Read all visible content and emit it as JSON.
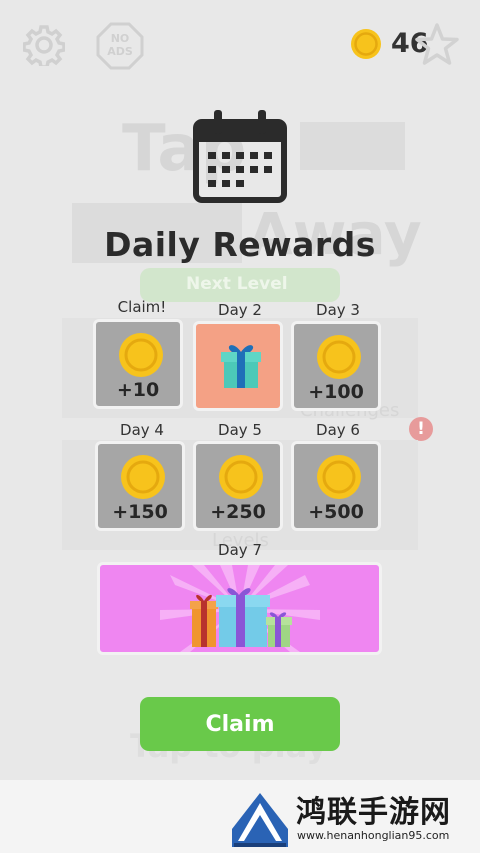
{
  "top_bar": {
    "settings_icon": "gear-icon",
    "no_ads_label": "NO\nADS",
    "no_ads_line1": "NO",
    "no_ads_line2": "ADS",
    "coin_icon": "coin-icon",
    "coin_count": "46",
    "star_icon": "star-icon"
  },
  "background": {
    "title_ghost": "Tap",
    "away_ghost": "Away",
    "next_level": "Next Level",
    "challenges": "Challenges",
    "alert": "!",
    "levels": "Levels",
    "tap_to_play": "Tap to play"
  },
  "modal": {
    "title": "Daily Rewards",
    "calendar_icon": "calendar-icon",
    "rewards": [
      {
        "label": "Claim!",
        "amount": "+10",
        "type": "coin",
        "state": "claimable"
      },
      {
        "label": "Day 2",
        "amount": "",
        "type": "gift",
        "state": "highlight"
      },
      {
        "label": "Day 3",
        "amount": "+100",
        "type": "coin",
        "state": "locked"
      },
      {
        "label": "Day 4",
        "amount": "+150",
        "type": "coin",
        "state": "locked"
      },
      {
        "label": "Day 5",
        "amount": "+250",
        "type": "coin",
        "state": "locked"
      },
      {
        "label": "Day 6",
        "amount": "+500",
        "type": "coin",
        "state": "locked"
      }
    ],
    "day7": {
      "label": "Day 7",
      "type": "gift-bundle"
    },
    "claim_label": "Claim"
  },
  "colors": {
    "tile_locked": "#a6a6a6",
    "tile_highlight": "#f4a185",
    "tile_day7": "#ef86f1",
    "claim_green": "#69c94a",
    "coin_gold": "#f7c31c"
  },
  "watermark": {
    "title": "鸿联手游网",
    "url": "www.henanhonglian95.com"
  }
}
